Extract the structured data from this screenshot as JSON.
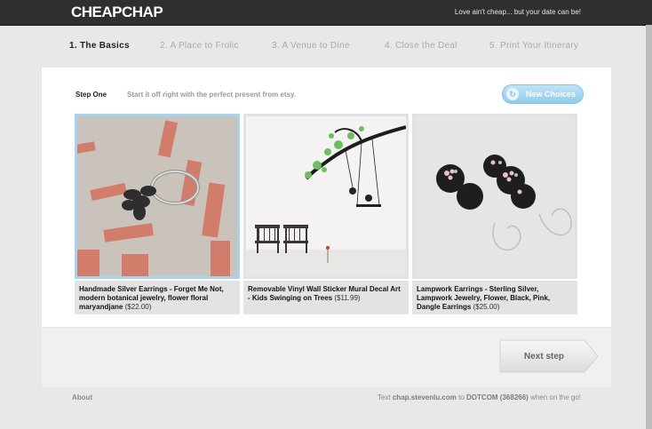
{
  "header": {
    "logo": "CHEAPCHAP",
    "tagline": "Love ain't cheap... but your date can be!"
  },
  "steps": [
    {
      "label": "1. The Basics",
      "active": true
    },
    {
      "label": "2. A Place to Frolic",
      "active": false
    },
    {
      "label": "3. A Venue to Dine",
      "active": false
    },
    {
      "label": "4. Close the Deal",
      "active": false
    },
    {
      "label": "5. Print Your Itinerary",
      "active": false
    }
  ],
  "main": {
    "step_label": "Step One",
    "step_desc": "Start it off right with the perfect present from etsy.",
    "new_choices_label": "New Choices",
    "new_choices_icon": "refresh-icon",
    "next_label": "Next step"
  },
  "products": [
    {
      "title": "Handmade Silver Earrings - Forget Me Not, modern botanical jewelry, flower floral maryandjane",
      "price": "($22.00)",
      "selected": true
    },
    {
      "title": "Removable Vinyl Wall Sticker Mural Decal Art - Kids Swinging on Trees",
      "price": "($11.99)",
      "selected": false
    },
    {
      "title": "Lampwork Earrings - Sterling Silver, Lampwork Jewelry, Flower, Black, Pink, Dangle Earrings",
      "price": "($25.00)",
      "selected": false
    }
  ],
  "footer": {
    "about": "About",
    "text_prefix": "Text",
    "text_url": "chap.stevenlu.com",
    "text_mid": "to",
    "text_code": "DOTCOM (368266)",
    "text_suffix": "when on the go!"
  },
  "colors": {
    "accent": "#91cbec",
    "header_bg": "#2f2f2f",
    "selected_border": "#a7d3ee"
  }
}
